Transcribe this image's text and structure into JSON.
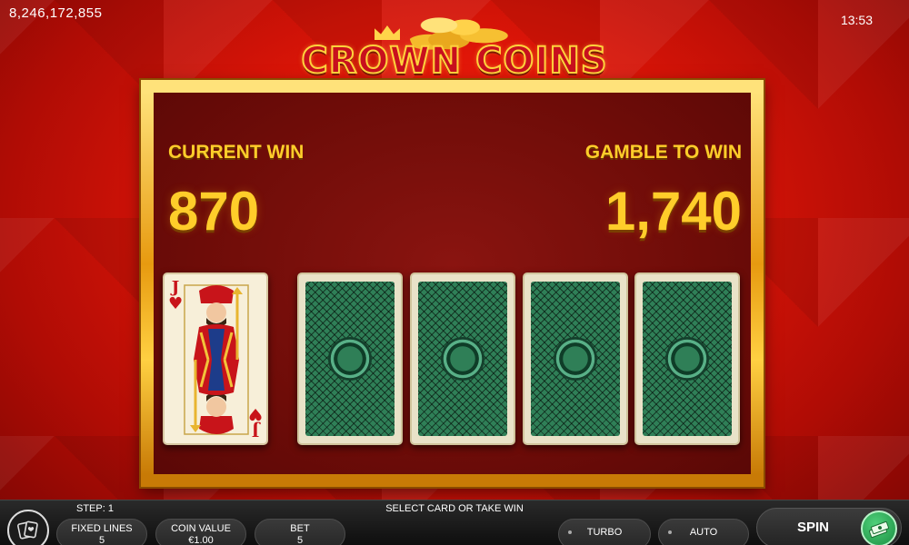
{
  "hud": {
    "balance": "8,246,172,855",
    "time": "13:53"
  },
  "logo": {
    "title": "CROWN COINS"
  },
  "gamble": {
    "current_win_label": "CURRENT WIN",
    "current_win_value": "870",
    "gamble_to_win_label": "GAMBLE TO WIN",
    "gamble_to_win_value": "1,740",
    "revealed_card": {
      "rank": "J",
      "suit": "hearts"
    },
    "hidden_cards": 4
  },
  "bottom_bar": {
    "step_label": "STEP: 1",
    "message": "SELECT CARD OR TAKE WIN",
    "fixed_lines_label": "FIXED LINES",
    "fixed_lines_value": "5",
    "coin_value_label": "COIN VALUE",
    "coin_value_value": "€1.00",
    "bet_label": "BET",
    "bet_value": "5",
    "turbo_label": "TURBO",
    "auto_label": "AUTO",
    "spin_label": "SPIN"
  },
  "icons": {
    "menu": "cards-menu-icon",
    "collect": "cash-stack-icon",
    "card_suit": "heart-icon"
  },
  "colors": {
    "accent_gold": "#ffcd2a",
    "background_red": "#e01608",
    "card_back_green": "#2f7f57",
    "collect_green": "#1b8f42"
  }
}
